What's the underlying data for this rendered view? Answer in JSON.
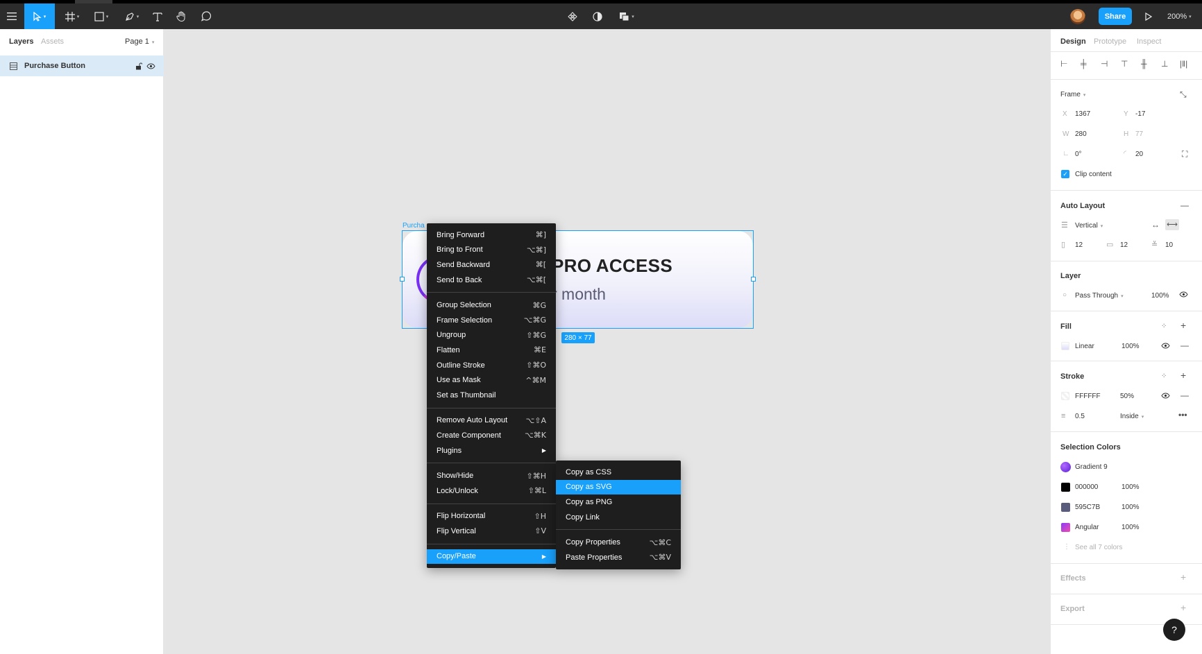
{
  "toolbar": {
    "share_label": "Share",
    "zoom_label": "200%",
    "icons": [
      "menu-icon",
      "move-tool-icon",
      "frame-tool-icon",
      "shape-tool-icon",
      "pen-tool-icon",
      "text-tool-icon",
      "hand-tool-icon",
      "comment-tool-icon",
      "component-icon",
      "mask-icon",
      "boolean-icon",
      "play-icon"
    ]
  },
  "left_panel": {
    "tabs": [
      "Layers",
      "Assets"
    ],
    "page_label": "Page 1",
    "layers": [
      {
        "label": "Purchase Button"
      }
    ]
  },
  "canvas": {
    "frame_label": "Purcha",
    "frame_title": "PRO ACCESS",
    "frame_subtitle": "r month",
    "size_badge": "280 × 77"
  },
  "context_menu": {
    "items": [
      {
        "label": "Bring Forward",
        "shortcut": "⌘]"
      },
      {
        "label": "Bring to Front",
        "shortcut": "⌥⌘]"
      },
      {
        "label": "Send Backward",
        "shortcut": "⌘["
      },
      {
        "label": "Send to Back",
        "shortcut": "⌥⌘["
      },
      {
        "label": "Group Selection",
        "shortcut": "⌘G"
      },
      {
        "label": "Frame Selection",
        "shortcut": "⌥⌘G"
      },
      {
        "label": "Ungroup",
        "shortcut": "⇧⌘G"
      },
      {
        "label": "Flatten",
        "shortcut": "⌘E"
      },
      {
        "label": "Outline Stroke",
        "shortcut": "⇧⌘O"
      },
      {
        "label": "Use as Mask",
        "shortcut": "^⌘M"
      },
      {
        "label": "Set as Thumbnail",
        "shortcut": ""
      },
      {
        "label": "Remove Auto Layout",
        "shortcut": "⌥⇧A"
      },
      {
        "label": "Create Component",
        "shortcut": "⌥⌘K"
      },
      {
        "label": "Plugins",
        "shortcut": ""
      },
      {
        "label": "Show/Hide",
        "shortcut": "⇧⌘H"
      },
      {
        "label": "Lock/Unlock",
        "shortcut": "⇧⌘L"
      },
      {
        "label": "Flip Horizontal",
        "shortcut": "⇧H"
      },
      {
        "label": "Flip Vertical",
        "shortcut": "⇧V"
      },
      {
        "label": "Copy/Paste",
        "shortcut": ""
      }
    ]
  },
  "submenu": {
    "items": [
      {
        "label": "Copy as CSS",
        "shortcut": ""
      },
      {
        "label": "Copy as SVG",
        "shortcut": ""
      },
      {
        "label": "Copy as PNG",
        "shortcut": ""
      },
      {
        "label": "Copy Link",
        "shortcut": ""
      },
      {
        "label": "Copy Properties",
        "shortcut": "⌥⌘C"
      },
      {
        "label": "Paste Properties",
        "shortcut": "⌥⌘V"
      }
    ]
  },
  "right_panel": {
    "tabs": [
      "Design",
      "Prototype",
      "Inspect"
    ],
    "frame": {
      "label": "Frame",
      "x_label": "X",
      "x": "1367",
      "y_label": "Y",
      "y": "-17",
      "w_label": "W",
      "w": "280",
      "h_label": "H",
      "h": "77",
      "rotation": "0°",
      "radius": "20",
      "clip_label": "Clip content"
    },
    "auto_layout": {
      "title": "Auto Layout",
      "direction": "Vertical",
      "padding_h": "12",
      "padding_v": "12",
      "spacing": "10"
    },
    "layer": {
      "title": "Layer",
      "blend": "Pass Through",
      "opacity": "100%"
    },
    "fill": {
      "title": "Fill",
      "type": "Linear",
      "opacity": "100%"
    },
    "stroke": {
      "title": "Stroke",
      "color": "FFFFFF",
      "opacity": "50%",
      "weight": "0.5",
      "position": "Inside"
    },
    "selection_colors": {
      "title": "Selection Colors",
      "items": [
        {
          "name": "Gradient 9",
          "opacity": "",
          "color": "#7b2ff7"
        },
        {
          "name": "000000",
          "opacity": "100%",
          "color": "#000000"
        },
        {
          "name": "595C7B",
          "opacity": "100%",
          "color": "#595c7b"
        },
        {
          "name": "Angular",
          "opacity": "100%",
          "color": "#d63bd0"
        }
      ],
      "see_all": "See all 7 colors"
    },
    "effects_title": "Effects",
    "export_title": "Export"
  },
  "help_label": "?",
  "colors": {
    "accent": "#18a0fb",
    "toolbar": "#2c2c2c",
    "canvas": "#e5e5e5",
    "menu": "#1e1e1e"
  }
}
